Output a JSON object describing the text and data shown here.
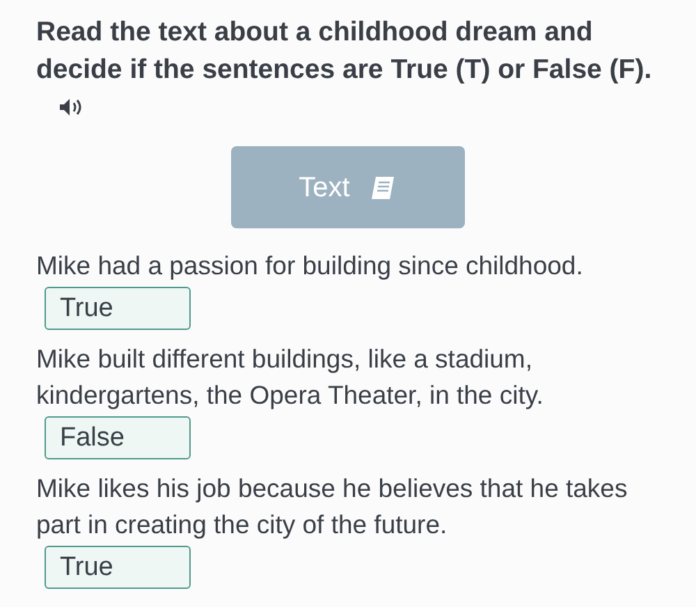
{
  "instruction": "Read the text about a childhood dream and decide if the sentences are True (T) or False (F).",
  "text_button": {
    "label": "Text"
  },
  "statements": [
    {
      "sentence": "Mike had a passion for building since childhood.",
      "answer": "True"
    },
    {
      "sentence": "Mike built different buildings, like a stadium, kindergartens, the Opera Theater, in the city.",
      "answer": "False"
    },
    {
      "sentence": "Mike likes his job because he believes that he takes part in creating the city of the future.",
      "answer": "True"
    }
  ]
}
